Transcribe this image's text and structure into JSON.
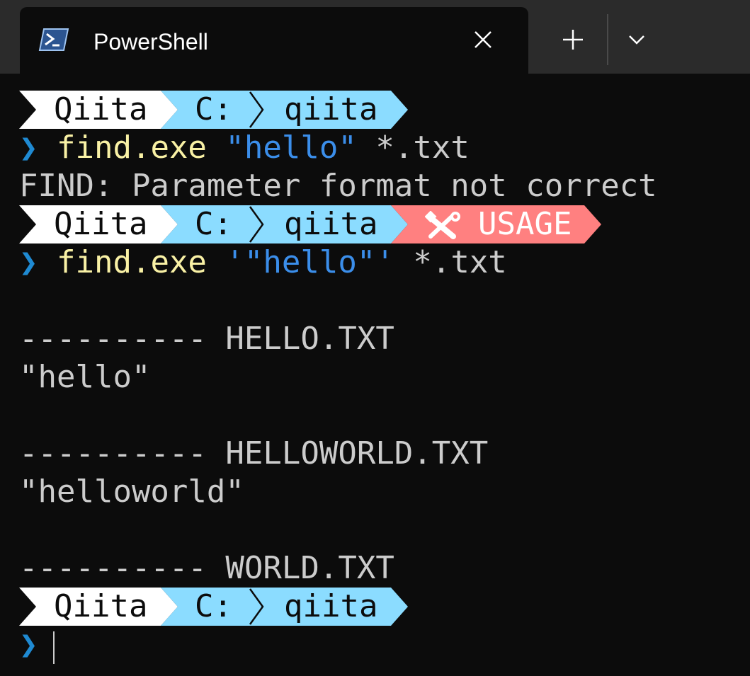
{
  "window": {
    "tab_title": "PowerShell",
    "icons": {
      "tab_icon": "powershell-icon",
      "close": "close-icon",
      "new_tab": "plus-icon",
      "dropdown": "chevron-down-icon"
    }
  },
  "colors": {
    "background": "#0c0c0c",
    "titlebar": "#2b2b2b",
    "prompt_white": "#ffffff",
    "prompt_blue": "#8bdcff",
    "prompt_error": "#ff8080",
    "command_yellow": "#f9f1a5",
    "string_blue": "#3b8eea",
    "chevron_blue": "#1f8ad2",
    "text_gray": "#cccccc"
  },
  "prompts": [
    {
      "user": "Qiita",
      "drive": "C:",
      "folder": "qiita",
      "status": ""
    },
    {
      "user": "Qiita",
      "drive": "C:",
      "folder": "qiita",
      "status": "USAGE",
      "status_icon": "tools-icon"
    },
    {
      "user": "Qiita",
      "drive": "C:",
      "folder": "qiita",
      "status": ""
    }
  ],
  "commands": [
    {
      "chevron": "❯",
      "exe": "find.exe",
      "string": "\"hello\"",
      "args": "*.txt"
    },
    {
      "chevron": "❯",
      "exe": "find.exe",
      "string": "'\"hello\"'",
      "args": "*.txt"
    },
    {
      "chevron": "❯",
      "exe": "",
      "string": "",
      "args": ""
    }
  ],
  "output": {
    "error": "FIND: Parameter format not correct",
    "results": [
      {
        "header": "---------- HELLO.TXT",
        "match": "\"hello\""
      },
      {
        "header": "---------- HELLOWORLD.TXT",
        "match": "\"helloworld\""
      },
      {
        "header": "---------- WORLD.TXT",
        "match": ""
      }
    ]
  }
}
